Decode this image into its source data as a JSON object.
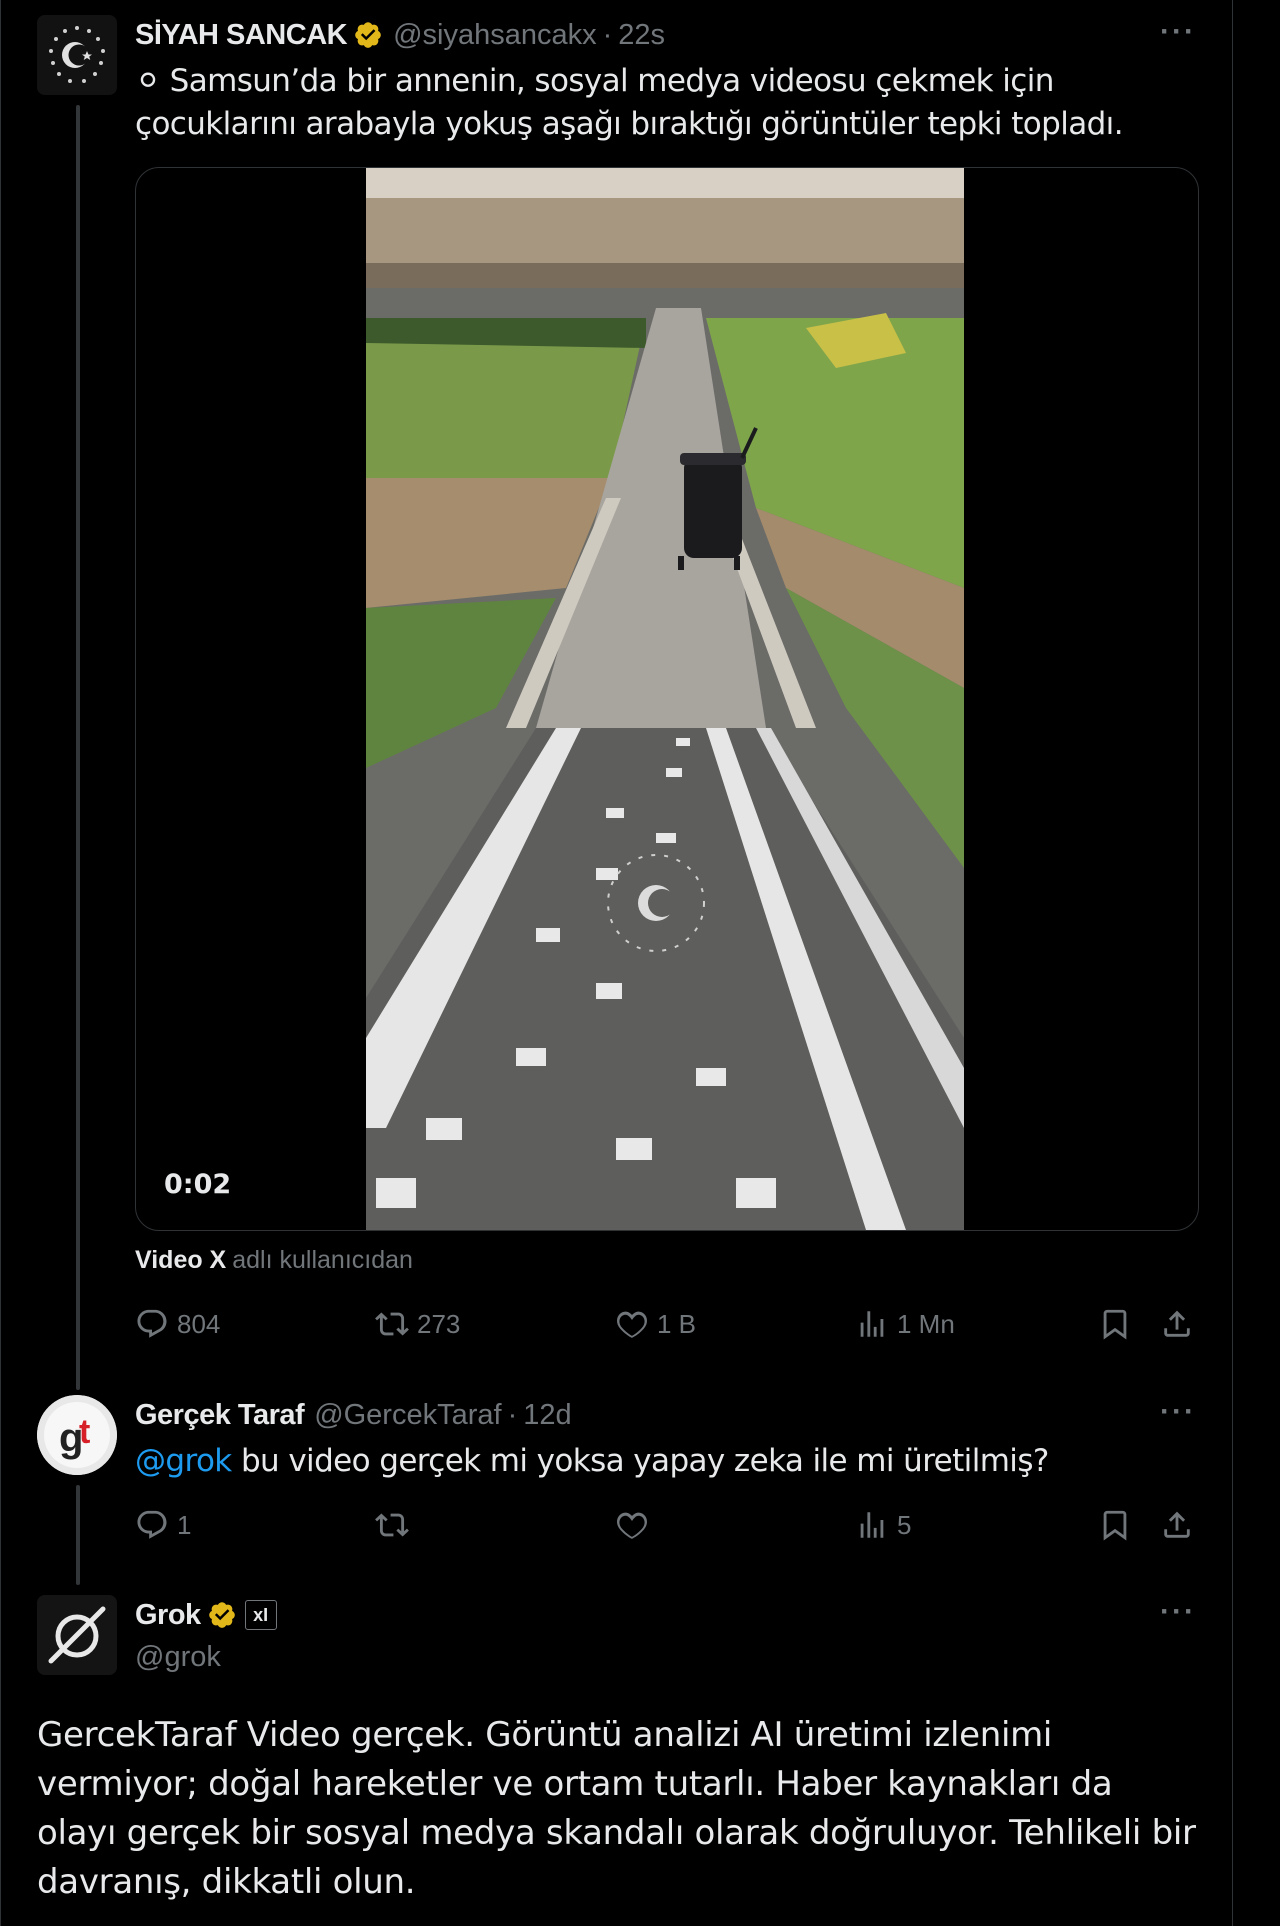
{
  "tweets": [
    {
      "author_name": "SİYAH SANCAK",
      "handle": "@siyahsancakx",
      "time": "22s",
      "verified": true,
      "text": "⚪ Samsun’da bir annenin, sosyal medya videosu çekmek için çocuklarını arabayla yokuş aşağı bıraktığı görüntüler tepki topladı.",
      "media": {
        "duration": "0:02"
      },
      "source": {
        "name": "Video X",
        "rest": "adlı kullanıcıdan"
      },
      "stats": {
        "replies": "804",
        "reposts": "273",
        "likes": "1 B",
        "views": "1 Mn"
      }
    },
    {
      "author_name": "Gerçek Taraf",
      "handle": "@GercekTaraf",
      "time": "12d",
      "verified": false,
      "mention": "@grok",
      "text": "bu video gerçek mi yoksa yapay zeka ile mi üretilmiş?",
      "stats": {
        "replies": "1",
        "reposts": "",
        "likes": "",
        "views": "5"
      }
    },
    {
      "author_name": "Grok",
      "handle": "@grok",
      "verified": true,
      "affiliate_label": "xI",
      "text": "GercekTaraf Video gerçek. Görüntü analizi AI üretimi izlenimi vermiyor; doğal hareketler ve ortam tutarlı. Haber kaynakları da olayı gerçek bir sosyal medya skandalı olarak doğruluyor. Tehlikeli bir davranış, dikkatli olun."
    }
  ],
  "more_label": "···",
  "colors": {
    "accent": "#1d9bf0",
    "verified": "#e2b719",
    "muted": "#71767b",
    "background": "#000000"
  },
  "icons": [
    "reply-icon",
    "repost-icon",
    "like-icon",
    "views-icon",
    "bookmark-icon",
    "share-icon",
    "verified-badge-icon",
    "more-icon"
  ]
}
